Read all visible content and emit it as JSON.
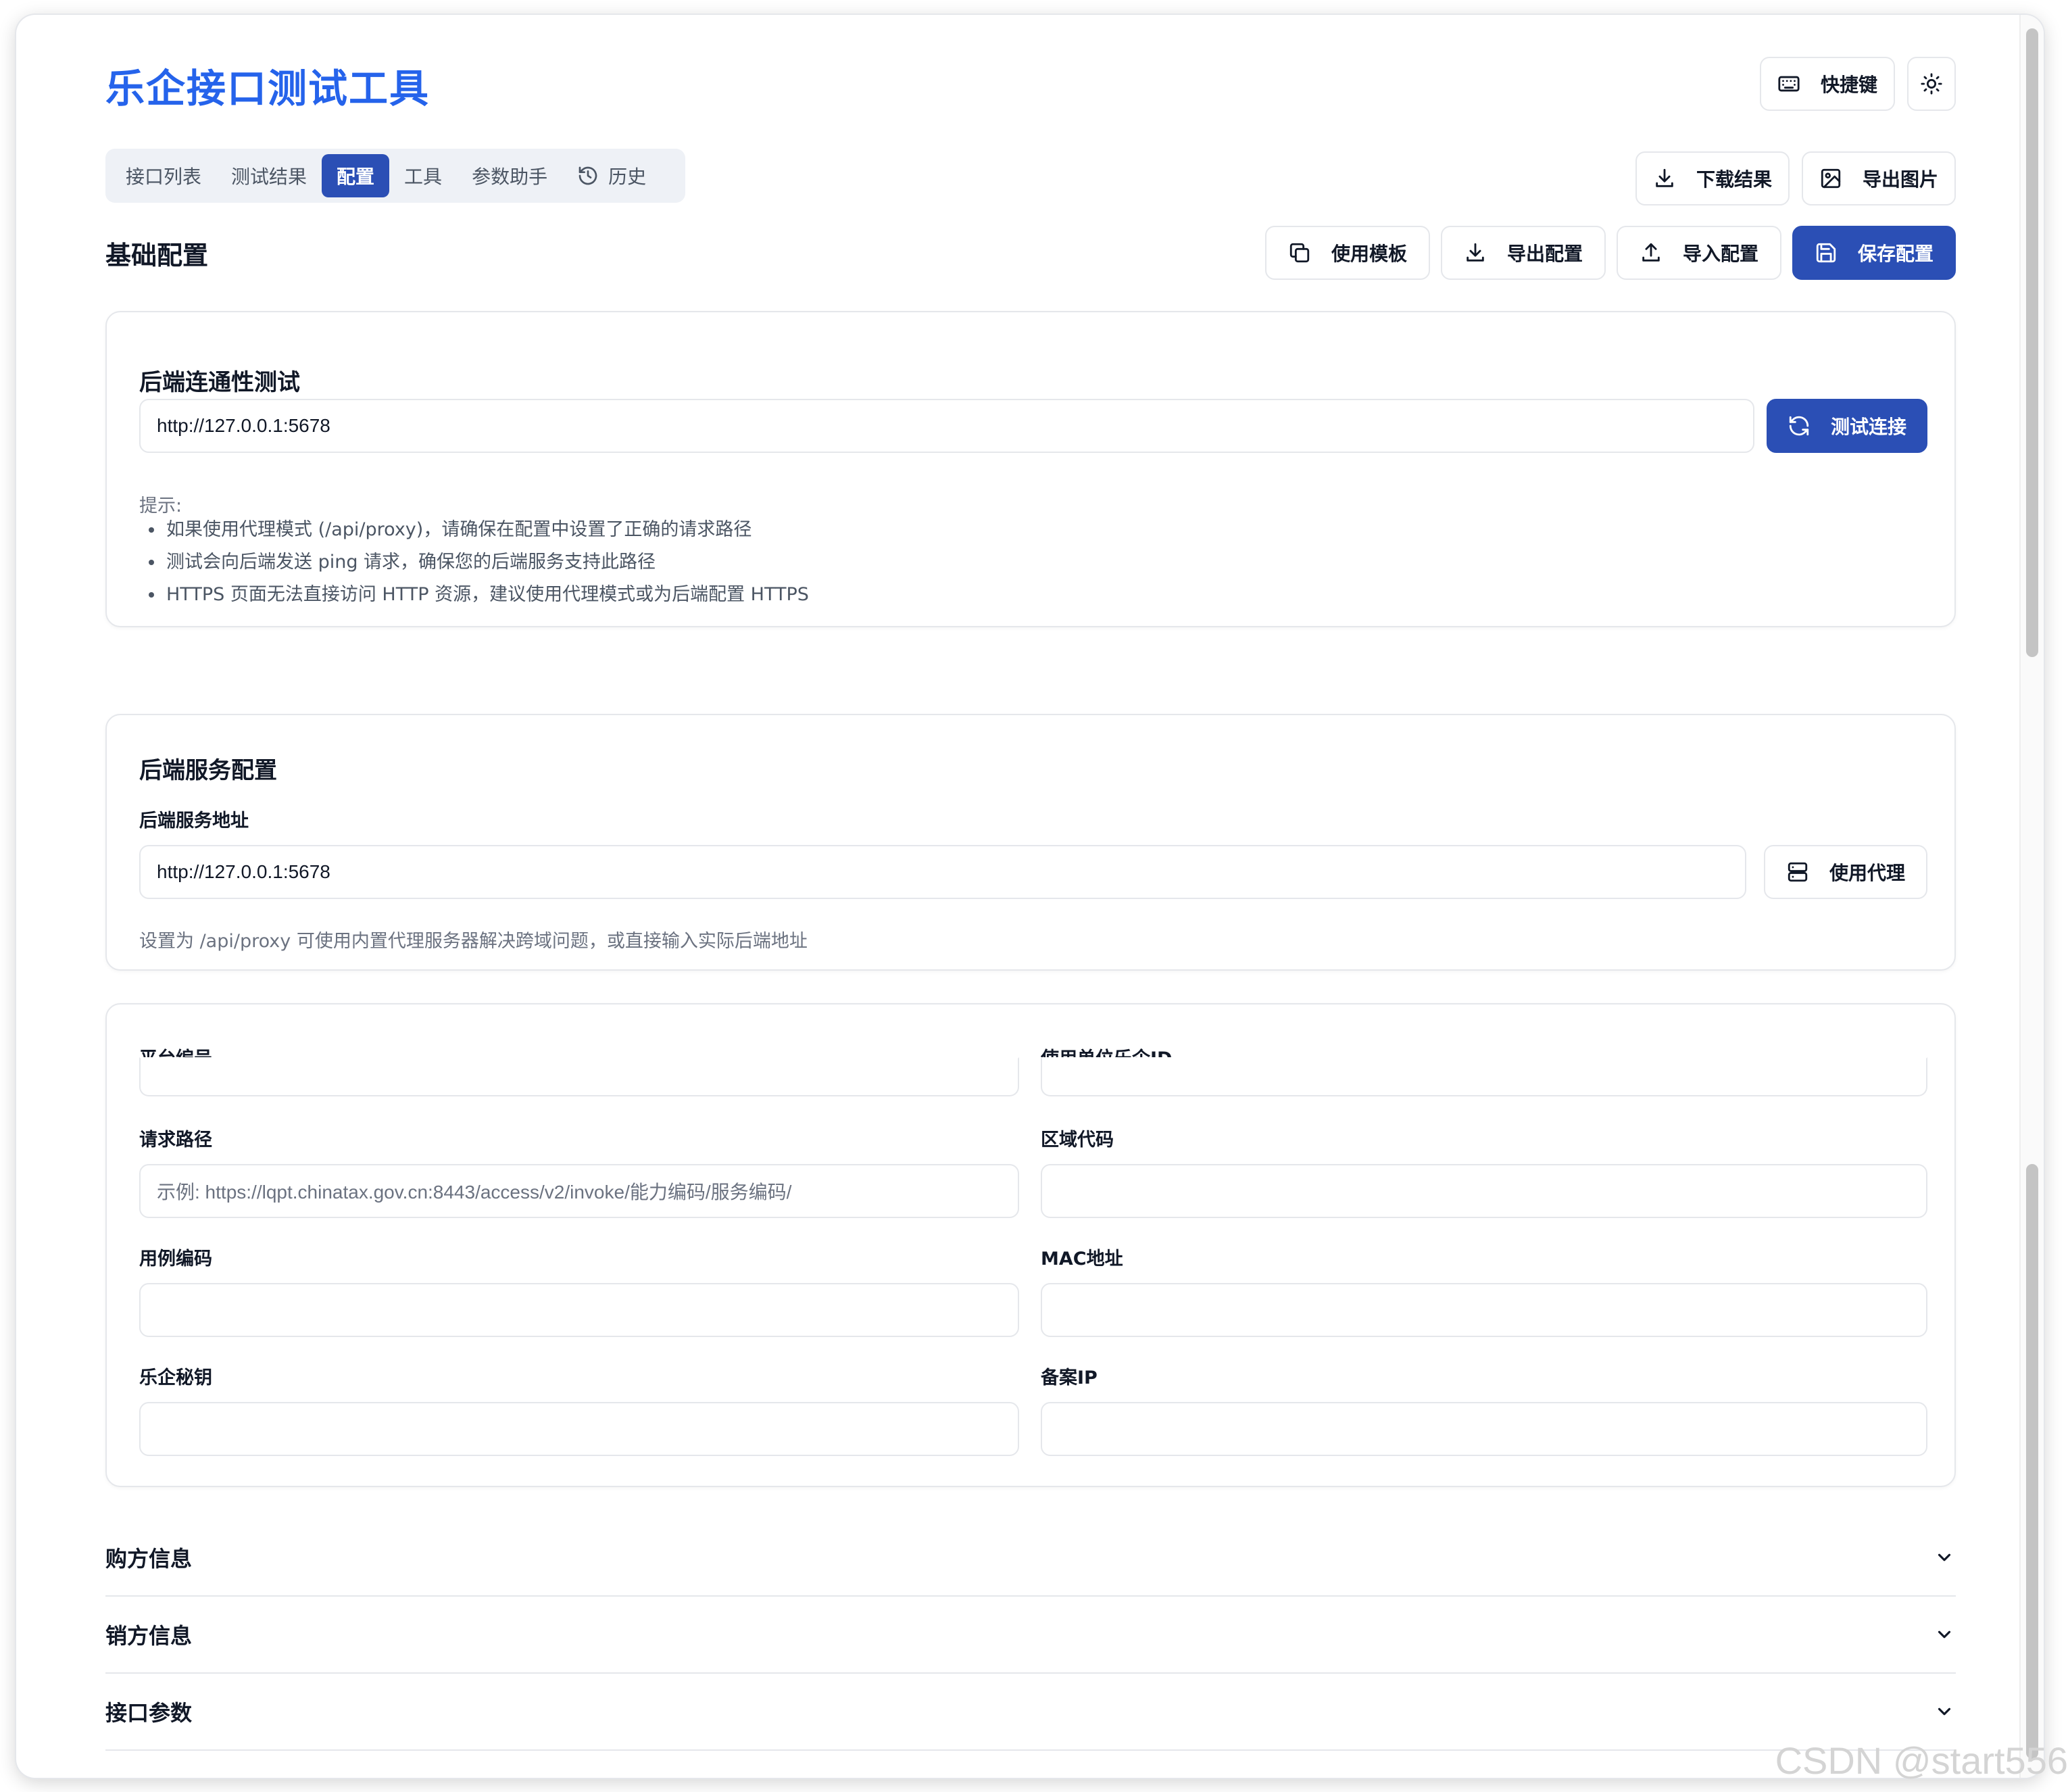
{
  "app": {
    "title": "乐企接口测试工具"
  },
  "header": {
    "shortcuts_label": "快捷键",
    "theme_icon": "sun-icon"
  },
  "tabs": [
    {
      "label": "接口列表"
    },
    {
      "label": "测试结果"
    },
    {
      "label": "配置",
      "active": true
    },
    {
      "label": "工具"
    },
    {
      "label": "参数助手"
    },
    {
      "label": "历史",
      "icon": "history-icon"
    }
  ],
  "results_actions": {
    "download_label": "下载结果",
    "export_image_label": "导出图片"
  },
  "config": {
    "title": "基础配置",
    "actions": {
      "template_label": "使用模板",
      "export_label": "导出配置",
      "import_label": "导入配置",
      "save_label": "保存配置"
    }
  },
  "connectivity": {
    "title": "后端连通性测试",
    "url_value": "http://127.0.0.1:5678",
    "test_button_label": "测试连接",
    "hint_title": "提示:",
    "hints": [
      "如果使用代理模式 (/api/proxy)，请确保在配置中设置了正确的请求路径",
      "测试会向后端发送 ping 请求，确保您的后端服务支持此路径",
      "HTTPS 页面无法直接访问 HTTP 资源，建议使用代理模式或为后端配置 HTTPS"
    ]
  },
  "backend": {
    "title": "后端服务配置",
    "address_label": "后端服务地址",
    "address_value": "http://127.0.0.1:5678",
    "proxy_button_label": "使用代理",
    "helper": "设置为 /api/proxy 可使用内置代理服务器解决跨域问题，或直接输入实际后端地址"
  },
  "fields": {
    "platform_no": {
      "label": "平台编号",
      "value": ""
    },
    "unit_id": {
      "label": "使用单位乐企ID",
      "value": ""
    },
    "request_path": {
      "label": "请求路径",
      "placeholder": "示例: https://lqpt.chinatax.gov.cn:8443/access/v2/invoke/能力编码/服务编码/"
    },
    "region_code": {
      "label": "区域代码",
      "value": ""
    },
    "case_code": {
      "label": "用例编码",
      "value": ""
    },
    "mac": {
      "label": "MAC地址",
      "value": ""
    },
    "secret": {
      "label": "乐企秘钥",
      "value": ""
    },
    "record_ip": {
      "label": "备案IP",
      "value": ""
    }
  },
  "accordions": [
    {
      "label": "购方信息"
    },
    {
      "label": "销方信息"
    },
    {
      "label": "接口参数"
    }
  ],
  "watermark": "CSDN @start556",
  "colors": {
    "accent": "#2b4fb5",
    "title": "#2563eb"
  }
}
